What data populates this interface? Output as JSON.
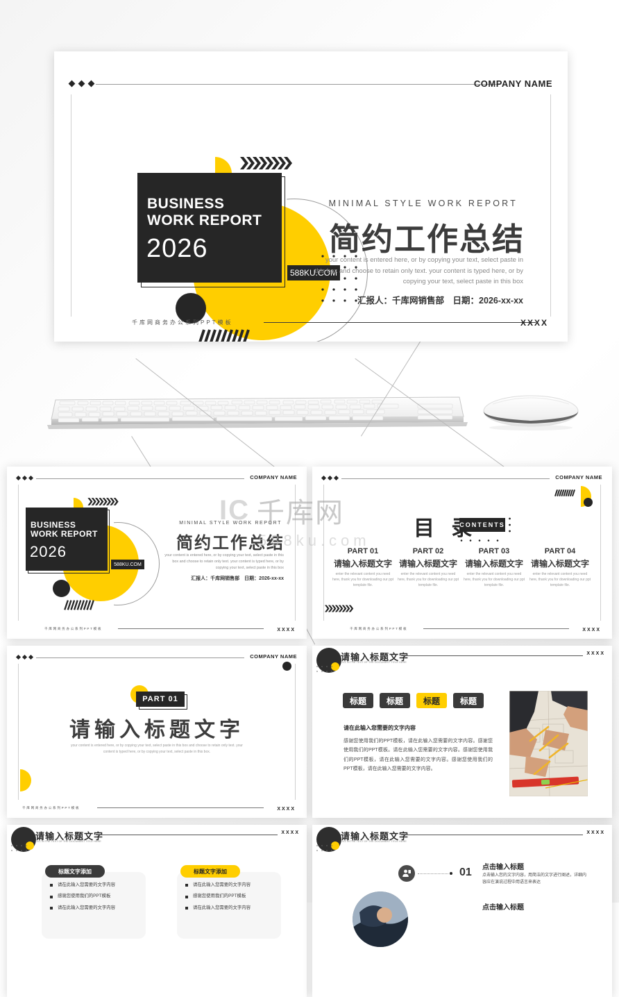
{
  "brand": {
    "yellow": "#FFCE00",
    "dark": "#262626",
    "gray": "#9a9a9a"
  },
  "watermark": {
    "logo": "IC",
    "name": "千库网",
    "url": "588ku.com"
  },
  "common": {
    "company_name": "COMPANY NAME",
    "footer_cn": "千库网商务办公系列PPT模板",
    "footer_x": "XXXX",
    "header_title_cn": "请输入标题文字",
    "header_title_en": "FILL IN THE TEXT OF THE DOCUMENT TITLE HERE"
  },
  "cover": {
    "badge_line1": "BUSINESS",
    "badge_line2": "WORK REPORT",
    "badge_year": "2026",
    "tag": "588KU.COM",
    "eyebrow": "MINIMAL STYLE WORK REPORT",
    "title": "简约工作总结",
    "paragraph": "your content is entered here, or by copying your text, select paste in this box and choose to retain only text. your content is typed here, or by copying your text, select paste in this box",
    "byline": "汇报人：千库网销售部　日期：2026-xx-xx"
  },
  "toc": {
    "title": "目 录",
    "chip": "CONTENTS",
    "parts": [
      {
        "no": "PART 01",
        "cn": "请输入标题文字",
        "en": "enter the relevant content you need here, thank you for downloading our ppt template file."
      },
      {
        "no": "PART 02",
        "cn": "请输入标题文字",
        "en": "enter the relevant content you need here, thank you for downloading our ppt template file."
      },
      {
        "no": "PART 03",
        "cn": "请输入标题文字",
        "en": "enter the relevant content you need here, thank you for downloading our ppt template file."
      },
      {
        "no": "PART 04",
        "cn": "请输入标题文字",
        "en": "enter the relevant content you need here, thank you for downloading our ppt template file."
      }
    ]
  },
  "section": {
    "chip": "PART 01",
    "title": "请输入标题文字",
    "paragraph": "your content is entered here, or by copying your text, select paste in this box and choose to retain only text. your content is typed here, or by copying your text, select paste in this box."
  },
  "tabs_slide": {
    "tabs": [
      {
        "label": "标题",
        "active": false
      },
      {
        "label": "标题",
        "active": false
      },
      {
        "label": "标题",
        "active": true
      },
      {
        "label": "标题",
        "active": false
      }
    ],
    "block_heading": "请在此输入您需要的文字内容",
    "block_paragraph": "感谢您使用我们的PPT模板，请在此输入您需要的文字内容。感谢您使用我们的PPT模板。请在此输入您需要的文字内容。感谢您使用我们的PPT模板，请在此输入您需要的文字内容。感谢您使用我们的PPT模板，请在此输入您需要的文字内容。",
    "photo_alt": "architects-blueprint-photo"
  },
  "cards_slide": {
    "cards": [
      {
        "pill": "标题文字添加",
        "style": "dark",
        "bullets": [
          "请在此输入您需要的文字内容",
          "感谢您使用我们的PPT模板",
          "请在此输入您需要的文字内容"
        ]
      },
      {
        "pill": "标题文字添加",
        "style": "yellow",
        "bullets": [
          "请在此输入您需要的文字内容",
          "感谢您使用我们的PPT模板",
          "请在此输入您需要的文字内容"
        ]
      }
    ]
  },
  "list_slide": {
    "items": [
      {
        "number": "01",
        "heading": "点击输入标题",
        "paragraph": "点击输入您的文字内容，用简洁的文字进行阐述，详细内容应在演说过程中用语言来表达"
      }
    ],
    "icon": "person-badge-icon",
    "avatar_alt": "person-photo"
  }
}
